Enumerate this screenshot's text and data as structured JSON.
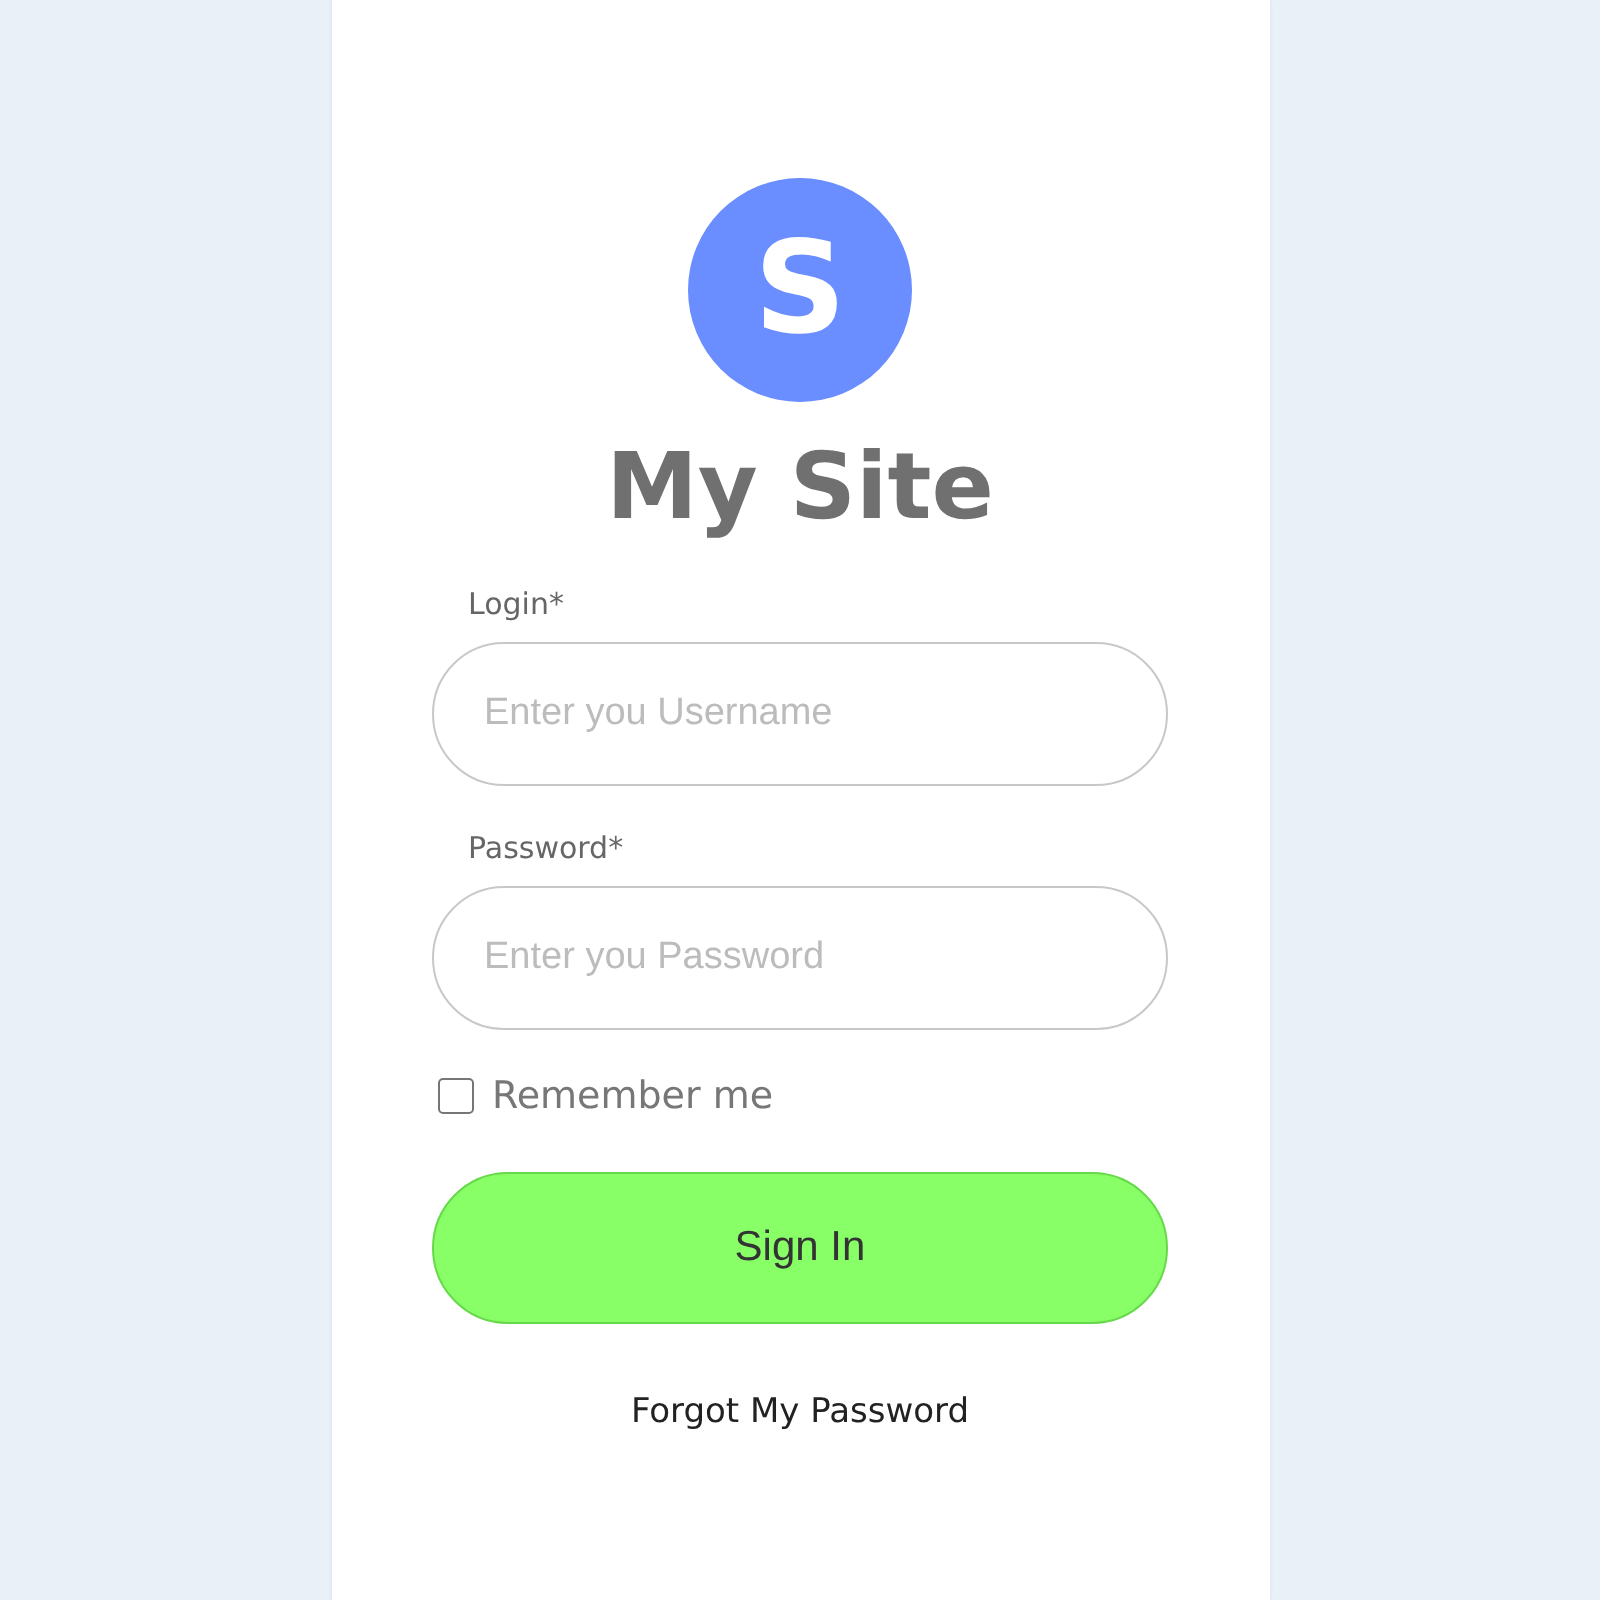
{
  "logo": {
    "letter": "S"
  },
  "title": "My Site",
  "fields": [
    {
      "label": "Login*",
      "placeholder": "Enter you Username"
    },
    {
      "label": "Password*",
      "placeholder": "Enter you Password"
    }
  ],
  "remember": {
    "label": "Remember me",
    "checked": false
  },
  "submit": {
    "label": "Sign In"
  },
  "forgot_link": "Forgot My Password"
}
